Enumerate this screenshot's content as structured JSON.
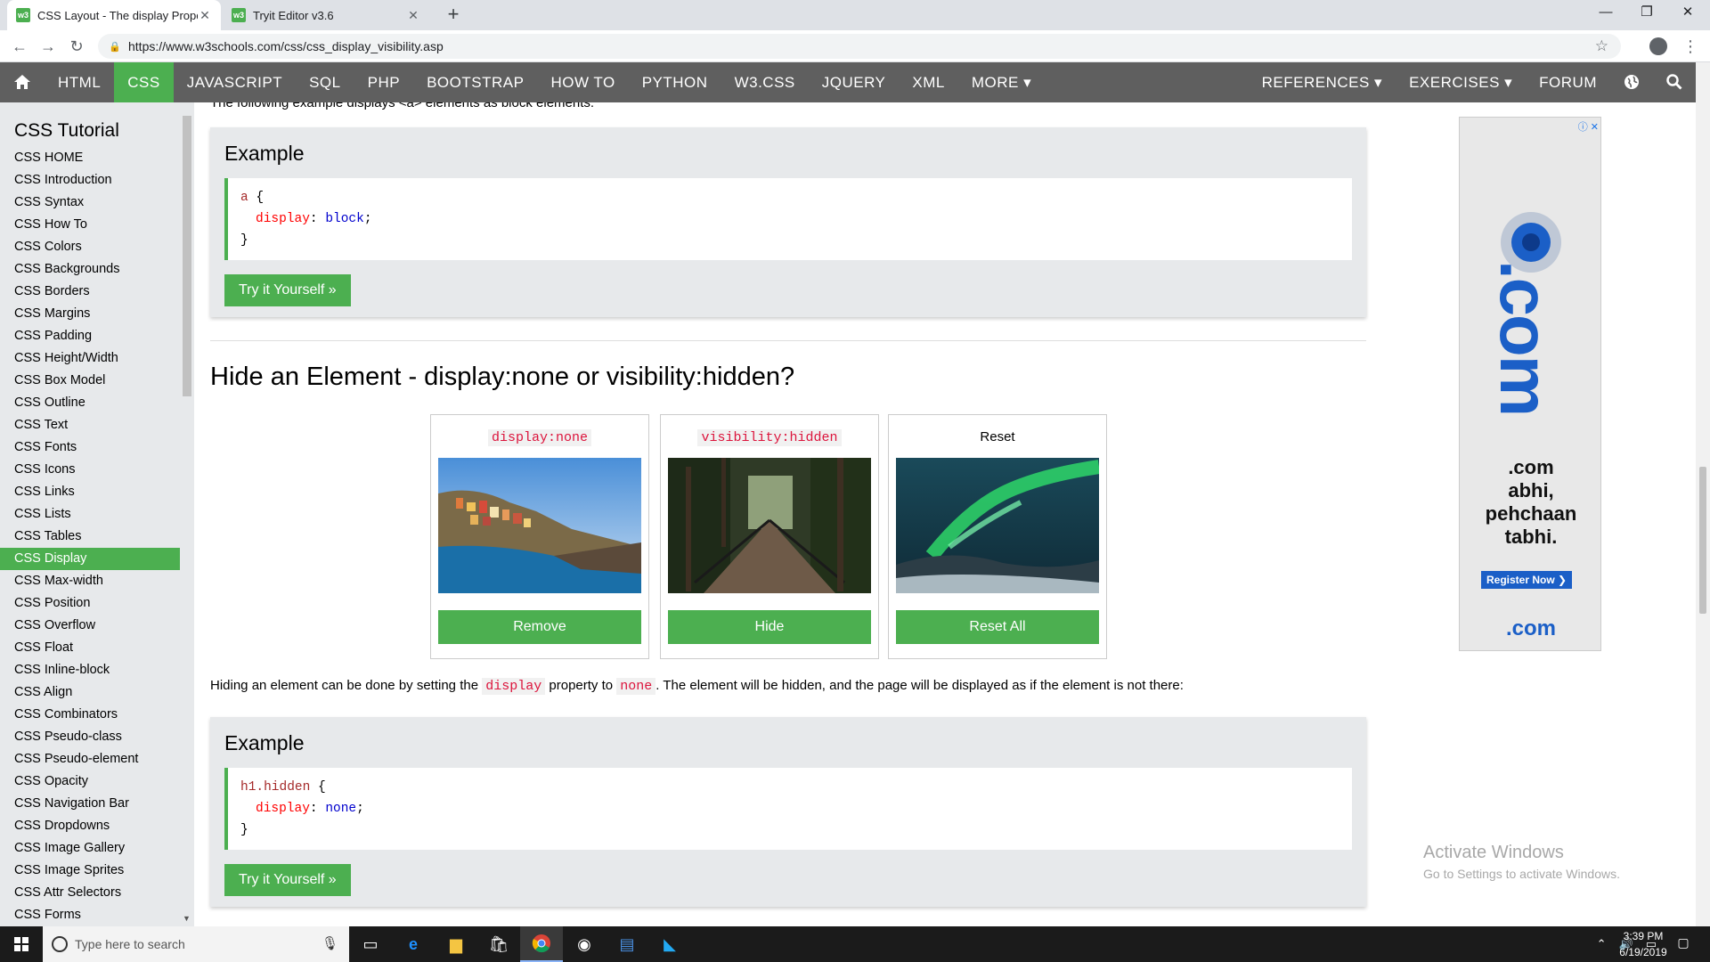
{
  "browser": {
    "tabs": [
      {
        "title": "CSS Layout - The display Propert",
        "favicon": "w3"
      },
      {
        "title": "Tryit Editor v3.6",
        "favicon": "w3"
      }
    ],
    "url": "https://www.w3schools.com/css/css_display_visibility.asp"
  },
  "topnav": {
    "left": [
      "HTML",
      "CSS",
      "JAVASCRIPT",
      "SQL",
      "PHP",
      "BOOTSTRAP",
      "HOW TO",
      "PYTHON",
      "W3.CSS",
      "JQUERY",
      "XML",
      "MORE ▾"
    ],
    "active": "CSS",
    "right": [
      "REFERENCES ▾",
      "EXERCISES ▾",
      "FORUM"
    ]
  },
  "sidebar": {
    "title": "CSS Tutorial",
    "items": [
      "CSS HOME",
      "CSS Introduction",
      "CSS Syntax",
      "CSS How To",
      "CSS Colors",
      "CSS Backgrounds",
      "CSS Borders",
      "CSS Margins",
      "CSS Padding",
      "CSS Height/Width",
      "CSS Box Model",
      "CSS Outline",
      "CSS Text",
      "CSS Fonts",
      "CSS Icons",
      "CSS Links",
      "CSS Lists",
      "CSS Tables",
      "CSS Display",
      "CSS Max-width",
      "CSS Position",
      "CSS Overflow",
      "CSS Float",
      "CSS Inline-block",
      "CSS Align",
      "CSS Combinators",
      "CSS Pseudo-class",
      "CSS Pseudo-element",
      "CSS Opacity",
      "CSS Navigation Bar",
      "CSS Dropdowns",
      "CSS Image Gallery",
      "CSS Image Sprites",
      "CSS Attr Selectors",
      "CSS Forms"
    ],
    "active_index": 18
  },
  "main": {
    "cutoff_text": "The following example displays <a> elements as block elements:",
    "example1": {
      "heading": "Example",
      "code_sel": "a",
      "code_open": " {",
      "code_prop": "display",
      "code_colon": ": ",
      "code_val": "block",
      "code_semi": ";",
      "code_close": "}",
      "button": "Try it Yourself »"
    },
    "section_title": "Hide an Element - display:none or visibility:hidden?",
    "demos": [
      {
        "label": "display:none",
        "button": "Remove",
        "label_is_code": true
      },
      {
        "label": "visibility:hidden",
        "button": "Hide",
        "label_is_code": true
      },
      {
        "label": "Reset",
        "button": "Reset All",
        "label_is_code": false
      }
    ],
    "paragraph": {
      "part1": "Hiding an element can be done by setting the ",
      "code1": "display",
      "part2": " property to ",
      "code2": "none",
      "part3": ". The element will be hidden, and the page will be displayed as if the element is not there:"
    },
    "example2": {
      "heading": "Example",
      "code_sel": "h1.hidden",
      "code_open": " {",
      "code_prop": "display",
      "code_colon": ": ",
      "code_val": "none",
      "code_semi": ";",
      "code_close": "}",
      "button": "Try it Yourself »"
    }
  },
  "ad": {
    "big_text": ".com",
    "lines": [
      ".com",
      "abhi,",
      "pehchaan",
      "tabhi."
    ],
    "register": "Register Now",
    "logo": ".com"
  },
  "watermark": {
    "title": "Activate Windows",
    "subtitle": "Go to Settings to activate Windows."
  },
  "taskbar": {
    "search_placeholder": "Type here to search",
    "time": "3:39 PM",
    "date": "6/19/2019"
  },
  "colors": {
    "w3_green": "#4caf50",
    "nav_bg": "#5f5f5f",
    "sidebar_bg": "#e7e9eb",
    "code_red": "#dc143c"
  }
}
